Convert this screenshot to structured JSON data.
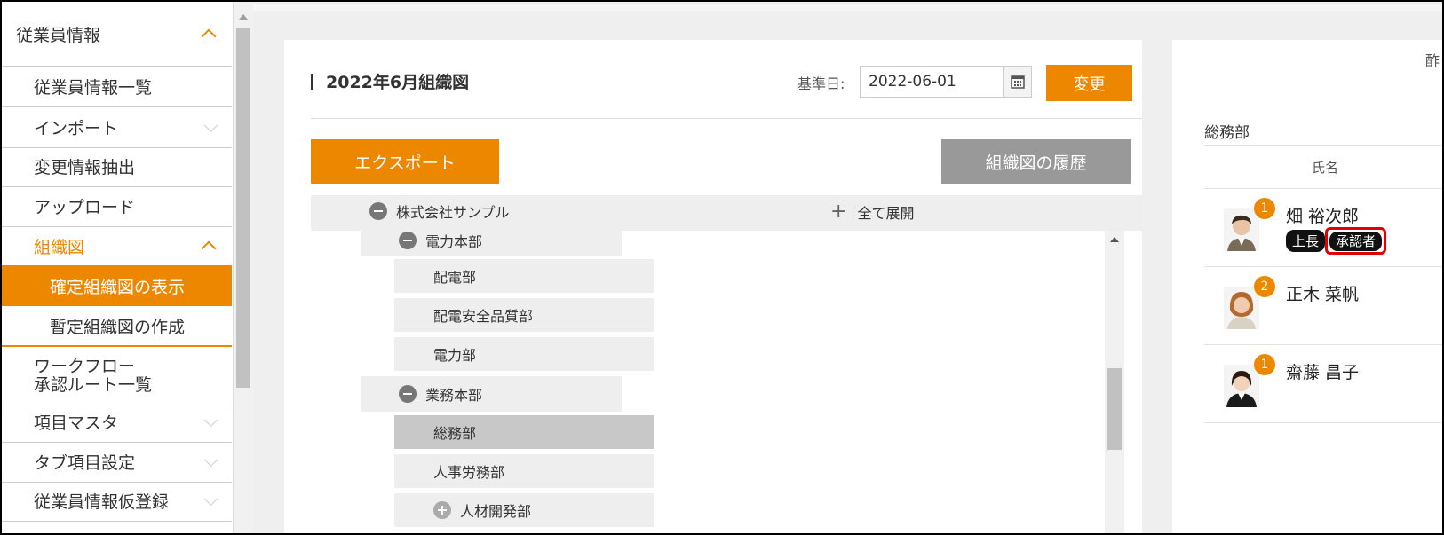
{
  "sidebar": {
    "header": "従業員情報",
    "items": [
      {
        "label": "従業員情報一覧"
      },
      {
        "label": "インポート"
      },
      {
        "label": "変更情報抽出"
      },
      {
        "label": "アップロード"
      },
      {
        "label": "組織図"
      },
      {
        "label": "確定組織図の表示"
      },
      {
        "label": "暫定組織図の作成"
      },
      {
        "label_line1": "ワークフロー",
        "label_line2": "承認ルート一覧"
      },
      {
        "label": "項目マスタ"
      },
      {
        "label": "タブ項目設定"
      },
      {
        "label": "従業員情報仮登録"
      }
    ]
  },
  "main": {
    "title": "2022年6月組織図",
    "date_label": "基準日:",
    "date_value": "2022-06-01",
    "change_label": "変更",
    "export_label": "エクスポート",
    "history_label": "組織図の履歴",
    "expand_all_label": "全て展開",
    "tree": {
      "root": "株式会社サンプル",
      "nodes": [
        {
          "label": "電力本部"
        },
        {
          "label": "配電部"
        },
        {
          "label": "配電安全品質部"
        },
        {
          "label": "電力部"
        },
        {
          "label": "業務本部"
        },
        {
          "label": "総務部"
        },
        {
          "label": "人事労務部"
        },
        {
          "label": "人材開発部"
        }
      ]
    }
  },
  "right_panel": {
    "cut_text": "酢",
    "dept": "総務部",
    "col_name": "氏名",
    "people": [
      {
        "num": "1",
        "name": "畑 裕次郎",
        "tag1": "上長",
        "tag2": "承認者"
      },
      {
        "num": "2",
        "name": "正木 菜帆"
      },
      {
        "num": "1",
        "name": "齋藤 昌子"
      }
    ]
  },
  "colors": {
    "accent": "#ee8700",
    "highlight": "#e00000"
  }
}
